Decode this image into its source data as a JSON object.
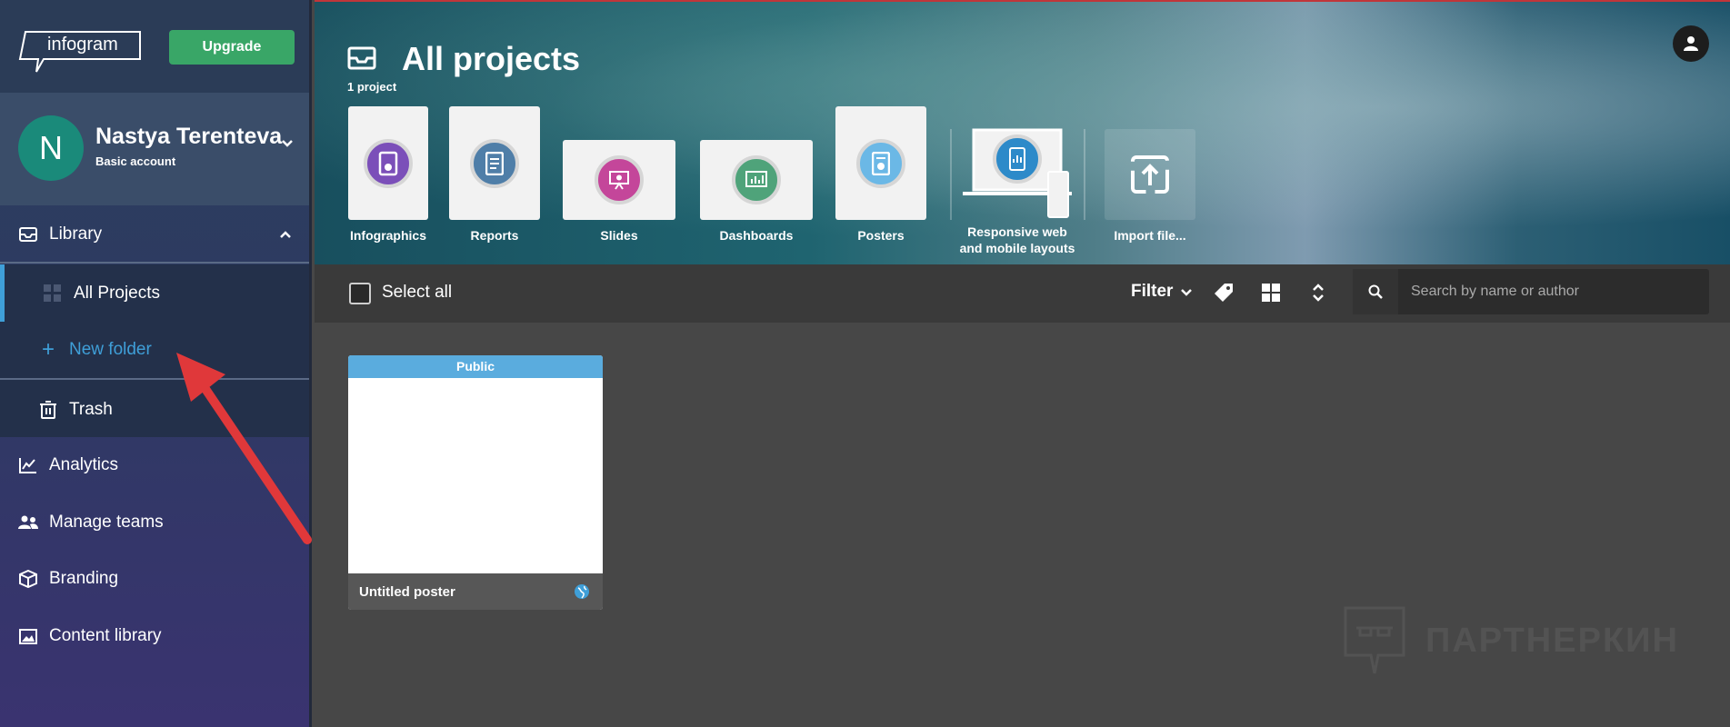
{
  "brand": {
    "logo_text": "infogram",
    "upgrade_label": "Upgrade"
  },
  "user": {
    "initial": "N",
    "name": "Nastya Terenteva",
    "plan": "Basic account"
  },
  "sidebar": {
    "library_label": "Library",
    "sub_items": {
      "all_projects": "All Projects",
      "new_folder": "New folder",
      "trash": "Trash"
    },
    "items": [
      {
        "label": "Analytics",
        "icon": "chart-icon"
      },
      {
        "label": "Manage teams",
        "icon": "team-icon"
      },
      {
        "label": "Branding",
        "icon": "cube-icon"
      },
      {
        "label": "Content library",
        "icon": "image-icon"
      }
    ]
  },
  "header": {
    "title": "All projects",
    "count": "1 project",
    "templates": [
      {
        "label": "Infographics",
        "color": "#7b4fb9"
      },
      {
        "label": "Reports",
        "color": "#4f7ea8"
      },
      {
        "label": "Slides",
        "color": "#c4469a"
      },
      {
        "label": "Dashboards",
        "color": "#4fa37a"
      },
      {
        "label": "Posters",
        "color": "#6bb8e6"
      },
      {
        "label": "Responsive web and mobile layouts",
        "color": "#2d8ac9"
      },
      {
        "label": "Import file..."
      }
    ]
  },
  "toolbar": {
    "select_all": "Select all",
    "filter": "Filter",
    "search_placeholder": "Search by name or author"
  },
  "projects": [
    {
      "status": "Public",
      "title": "Untitled poster"
    }
  ],
  "watermark": "ПАРТНЕРКИН",
  "colors": {
    "accent": "#3f9fd8",
    "upgrade": "#39a667",
    "annotation": "#e0383a"
  }
}
